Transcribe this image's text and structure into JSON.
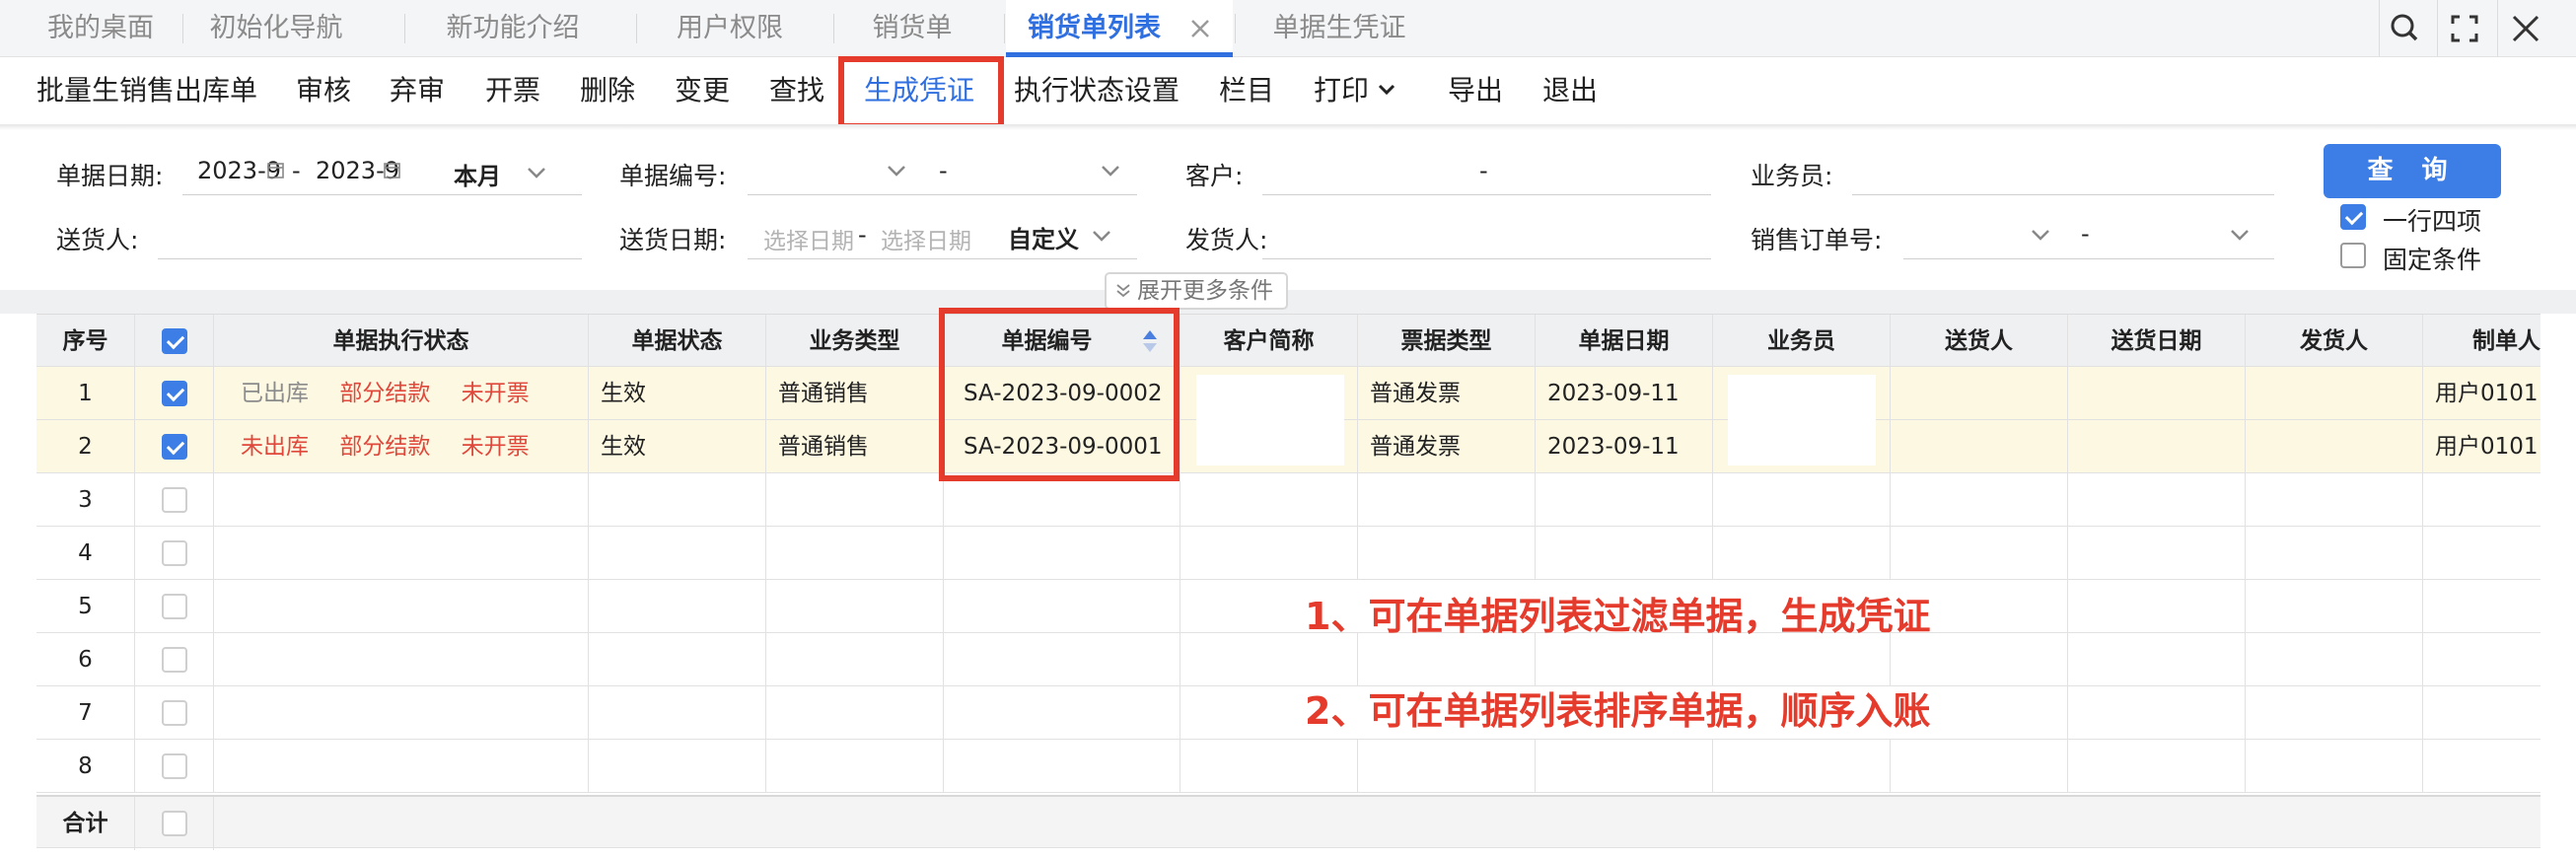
{
  "tabs": [
    {
      "label": "我的桌面"
    },
    {
      "label": "初始化导航"
    },
    {
      "label": "新功能介绍"
    },
    {
      "label": "用户权限"
    },
    {
      "label": "销货单"
    },
    {
      "label": "销货单列表"
    },
    {
      "label": "单据生凭证"
    }
  ],
  "active_tab": "销货单列表",
  "toolbar": [
    {
      "label": "批量生销售出库单"
    },
    {
      "label": "审核"
    },
    {
      "label": "弃审"
    },
    {
      "label": "开票"
    },
    {
      "label": "删除"
    },
    {
      "label": "变更"
    },
    {
      "label": "查找"
    },
    {
      "label": "生成凭证"
    },
    {
      "label": "执行状态设置"
    },
    {
      "label": "栏目"
    },
    {
      "label": "打印"
    },
    {
      "label": "导出"
    },
    {
      "label": "退出"
    }
  ],
  "filters": {
    "doc_date_label": "单据日期:",
    "doc_date_from": "2023-9",
    "doc_date_sep": "-",
    "doc_date_to": "2023-9",
    "doc_date_range": "本月",
    "doc_no_label": "单据编号:",
    "doc_no_sep": "-",
    "customer_label": "客户:",
    "customer_sep": "-",
    "salesman_label": "业务员:",
    "deliverer_label": "送货人:",
    "delivery_date_label": "送货日期:",
    "delivery_date_from_ph": "选择日期",
    "delivery_date_sep": "-",
    "delivery_date_to_ph": "选择日期",
    "delivery_date_range": "自定义",
    "shipper_label": "发货人:",
    "sales_order_label": "销售订单号:",
    "sales_order_sep": "-",
    "query_button": "查 询",
    "one_row_four": "一行四项",
    "one_row_four_checked": true,
    "fixed_conditions": "固定条件",
    "fixed_conditions_checked": false,
    "expand_more": "展开更多条件"
  },
  "table": {
    "columns": [
      "序号",
      "",
      "单据执行状态",
      "单据状态",
      "业务类型",
      "单据编号",
      "客户简称",
      "票据类型",
      "单据日期",
      "业务员",
      "送货人",
      "送货日期",
      "发货人",
      "制单人"
    ],
    "rows": [
      {
        "no": "1",
        "checked": true,
        "status1": "已出库",
        "status2": "部分结款",
        "status3": "未开票",
        "doc_status": "生效",
        "biz_type": "普通销售",
        "doc_no": "SA-2023-09-0002",
        "customer": "",
        "bill_type": "普通发票",
        "doc_date": "2023-09-11",
        "salesman": "",
        "deliverer": "",
        "delivery_date": "",
        "shipper": "",
        "maker": "用户0101"
      },
      {
        "no": "2",
        "checked": true,
        "status1": "未出库",
        "status2": "部分结款",
        "status3": "未开票",
        "doc_status": "生效",
        "biz_type": "普通销售",
        "doc_no": "SA-2023-09-0001",
        "customer": "",
        "bill_type": "普通发票",
        "doc_date": "2023-09-11",
        "salesman": "",
        "deliverer": "",
        "delivery_date": "",
        "shipper": "",
        "maker": "用户0101"
      },
      {
        "no": "3"
      },
      {
        "no": "4"
      },
      {
        "no": "5"
      },
      {
        "no": "6"
      },
      {
        "no": "7"
      },
      {
        "no": "8"
      }
    ],
    "total_label": "合计"
  },
  "annotations": [
    "1、可在单据列表过滤单据，生成凭证",
    "2、可在单据列表排序单据，顺序入账"
  ],
  "colors": {
    "accent": "#2f6fe0",
    "highlight_red": "#e53b2c",
    "row_highlight": "#fdf8e2"
  }
}
